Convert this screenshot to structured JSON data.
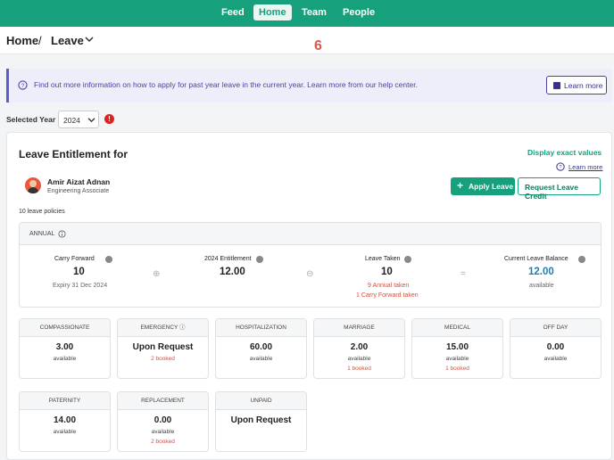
{
  "nav": {
    "items": [
      {
        "label": "Feed",
        "active": false
      },
      {
        "label": "Home",
        "active": true
      },
      {
        "label": "Team",
        "active": false
      },
      {
        "label": "People",
        "active": false
      }
    ]
  },
  "breadcrumb": {
    "home": "Home",
    "separator": "/",
    "current": "Leave"
  },
  "marker": "6",
  "banner": {
    "text": "Find out more information on how to apply for past year leave in the current year. Learn more from our help center.",
    "button_label": "Learn more"
  },
  "year": {
    "label": "Selected Year",
    "value": "2024",
    "warning": "!"
  },
  "entitlement": {
    "title": "Leave Entitlement for",
    "display_link": "Display exact values",
    "learn_more": "Learn more",
    "employee": {
      "name": "Amir Aizat Adnan",
      "role": "Engineering Associate"
    },
    "apply_button": "Apply Leave",
    "apply_plus": "+",
    "credit_button": "Request Leave Credit",
    "policy_count": "10 leave policies"
  },
  "annual": {
    "title": "ANNUAL",
    "operators": [
      "⊕",
      "⊖",
      "="
    ],
    "carry_forward": {
      "label": "Carry Forward",
      "value": "10",
      "sub": "Expiry 31 Dec 2024"
    },
    "entitlement": {
      "label": "2024 Entitlement",
      "value": "12.00"
    },
    "taken": {
      "label": "Leave Taken",
      "value": "10",
      "sub1": "9 Annual taken",
      "sub2": "1 Carry Forward taken"
    },
    "balance": {
      "label": "Current Leave Balance",
      "value": "12.00",
      "sub": "available"
    }
  },
  "policies": [
    {
      "name": "COMPASSIONATE",
      "value": "3.00",
      "available": "available",
      "booked": ""
    },
    {
      "name": "EMERGENCY",
      "value": "Upon Request",
      "available": "",
      "booked": "2 booked"
    },
    {
      "name": "HOSPITALIZATION",
      "value": "60.00",
      "available": "available",
      "booked": ""
    },
    {
      "name": "MARRIAGE",
      "value": "2.00",
      "available": "available",
      "booked": "1 booked"
    },
    {
      "name": "MEDICAL",
      "value": "15.00",
      "available": "available",
      "booked": "1 booked"
    },
    {
      "name": "OFF DAY",
      "value": "0.00",
      "available": "available",
      "booked": ""
    },
    {
      "name": "PATERNITY",
      "value": "14.00",
      "available": "available",
      "booked": ""
    },
    {
      "name": "REPLACEMENT",
      "value": "0.00",
      "available": "available",
      "booked": "2 booked"
    },
    {
      "name": "UNPAID",
      "value": "Upon Request",
      "available": "",
      "booked": ""
    }
  ],
  "colors": {
    "brand": "#17a07c",
    "banner_accent": "#5b5bd6",
    "booked": "#d0523e",
    "balance": "#1b7fb8"
  }
}
